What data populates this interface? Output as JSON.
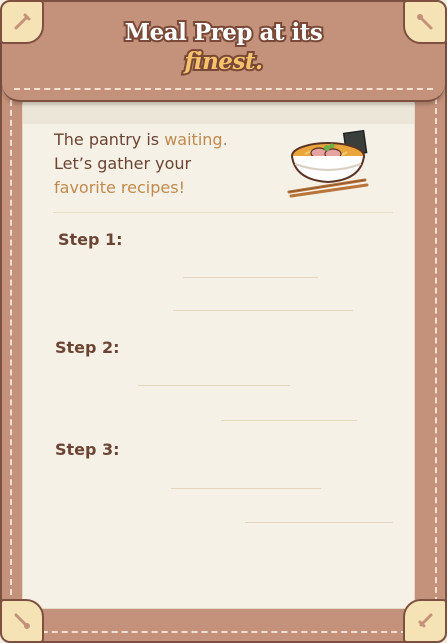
{
  "header": {
    "title_line1": "Meal Prep at its",
    "title_line2": "finest."
  },
  "intro": {
    "part1": "The pantry is ",
    "accent1": "waiting.",
    "part2": "Let’s gather your",
    "accent2": "favorite recipes!"
  },
  "steps": [
    {
      "label": "Step 1:"
    },
    {
      "label": "Step 2:"
    },
    {
      "label": "Step 3:"
    }
  ],
  "icons": {
    "corners": "utensil-icon",
    "illustration": "ramen-bowl-icon"
  },
  "colors": {
    "frame": "#c4927a",
    "border": "#7d5040",
    "paper": "#f5f1e6",
    "text": "#6b4433",
    "accent": "#c08a4e"
  }
}
